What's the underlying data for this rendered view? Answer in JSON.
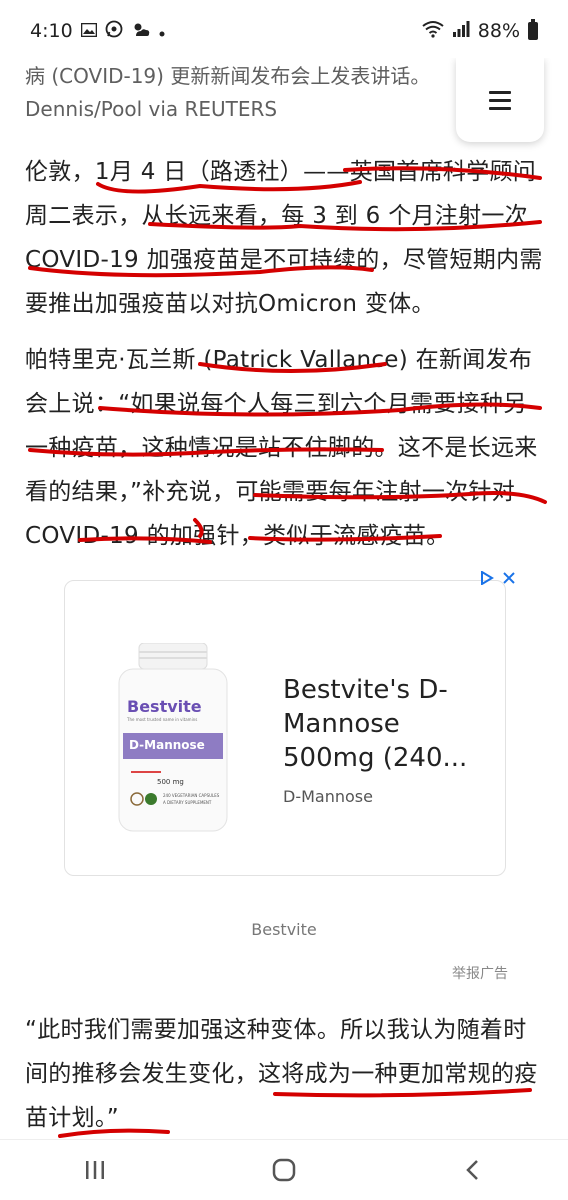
{
  "status_bar": {
    "time": "4:10",
    "battery": "88%",
    "left_icons": [
      "image-icon",
      "whatsapp-icon",
      "weather-icon",
      "dot-icon"
    ],
    "right_icons": [
      "wifi-icon",
      "signal-icon",
      "battery-icon"
    ]
  },
  "article": {
    "caption_line1": "病 (COVID-19) 更新新闻发布会上发表讲话。",
    "caption_line2": "Dennis/Pool via REUTERS",
    "para1": "伦敦，1月 4 日（路透社）——英国首席科学顾问周二表示，从长远来看，每 3 到 6 个月注射一次 COVID-19 加强疫苗是不可持续的，尽管短期内需要推出加强疫苗以对抗Omicron 变体。",
    "para2": "帕特里克·瓦兰斯 (Patrick Vallance) 在新闻发布会上说：“如果说每个人每三到六个月需要接种另一种疫苗，这种情况是站不住脚的。这不是长远来看的结果，”补充说，可能需要每年注射一次针对 COVID-19 的加强针，类似于流感疫苗。",
    "para3": "“此时我们需要加强这种变体。所以我认为随着时间的推移会发生变化，这将成为一种更加常规的疫苗计划。”",
    "annotation_color": "#d40000"
  },
  "ad": {
    "title": "Bestvite's D-Mannose 500mg (240...",
    "subtitle": "D-Mannose",
    "source": "Bestvite",
    "report": "举报广告",
    "product": {
      "brand": "Bestvite",
      "tagline": "The most trusted name in vitamins",
      "label": "D-Mannose",
      "dose": "500 mg",
      "capsule_note": "240 VEGETARIAN CAPSULES",
      "supplement_note": "A DIETARY SUPPLEMENT"
    },
    "choices_color": "#1a73e8"
  },
  "menu": {
    "icon": "hamburger-icon"
  },
  "nav": [
    "recent-apps-icon",
    "home-icon",
    "back-icon"
  ]
}
